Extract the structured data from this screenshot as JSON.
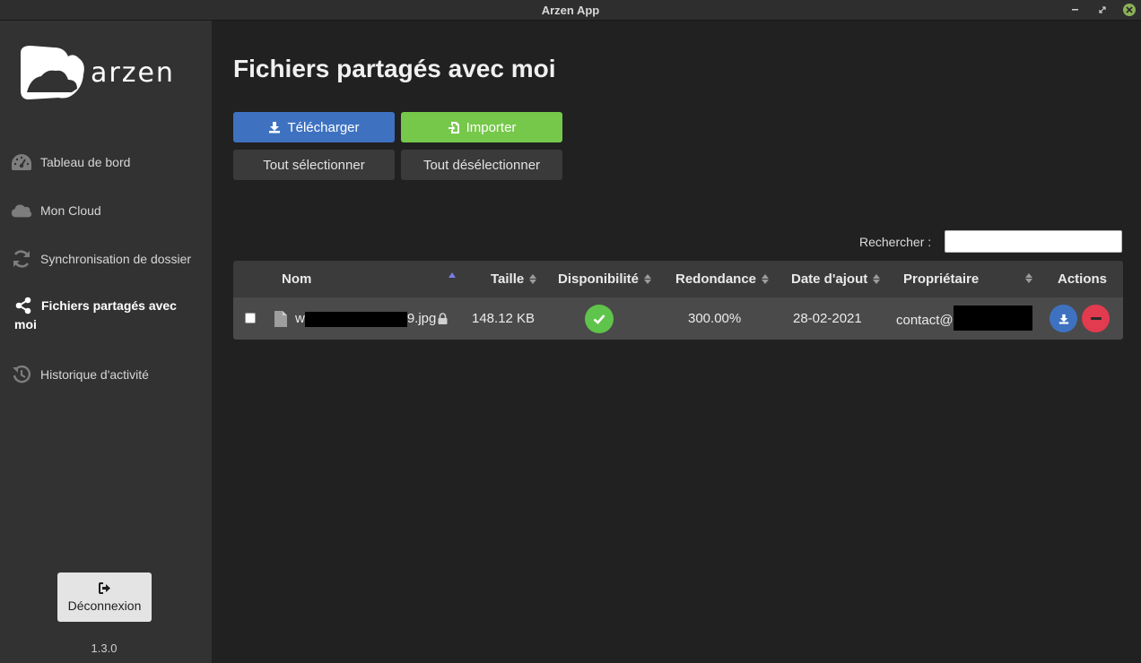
{
  "window": {
    "title": "Arzen App"
  },
  "sidebar": {
    "logo_text": "arzen",
    "items": [
      {
        "label": "Tableau de bord",
        "icon": "dashboard-gauge-icon"
      },
      {
        "label": "Mon Cloud",
        "icon": "cloud-icon"
      },
      {
        "label": "Synchronisation de dossier",
        "icon": "sync-icon"
      },
      {
        "label": "Fichiers partagés avec moi",
        "icon": "share-icon",
        "active": true
      },
      {
        "label": "Historique d'activité",
        "icon": "history-icon"
      }
    ],
    "logout_label": "Déconnexion",
    "version": "1.3.0"
  },
  "main": {
    "title": "Fichiers partagés avec moi",
    "buttons": {
      "download": "Télécharger",
      "import": "Importer",
      "select_all": "Tout sélectionner",
      "deselect_all": "Tout désélectionner"
    },
    "search": {
      "label": "Rechercher :",
      "value": ""
    },
    "table": {
      "columns": [
        "Nom",
        "Taille",
        "Disponibilité",
        "Redondance",
        "Date d'ajout",
        "Propriétaire",
        "Actions"
      ],
      "rows": [
        {
          "name_prefix": "w",
          "name_suffix": "9.jpg",
          "size": "148.12 KB",
          "availability": "ok",
          "redundancy": "300.00%",
          "date_added": "28-02-2021",
          "owner_prefix": "contact@"
        }
      ]
    }
  },
  "colors": {
    "primary_blue": "#3e72c1",
    "success_green": "#76c84a",
    "danger_red": "#e23a4e",
    "sidebar_bg": "#323232",
    "main_bg": "#212121"
  }
}
